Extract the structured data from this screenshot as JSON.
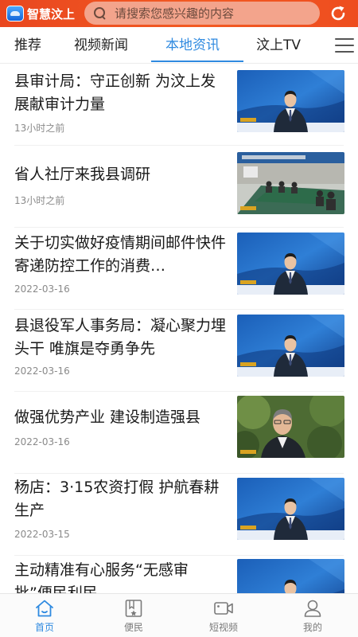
{
  "header": {
    "logo_text": "智慧汶上",
    "search_placeholder": "请搜索您感兴趣的内容",
    "accent_color": "#ee4d1f"
  },
  "tabs": [
    {
      "label": "推荐",
      "active": false
    },
    {
      "label": "视频新闻",
      "active": false
    },
    {
      "label": "本地资讯",
      "active": true
    },
    {
      "label": "汶上TV",
      "active": false
    }
  ],
  "tabs_menu_icon": "hamburger-menu-icon",
  "news": [
    {
      "title": "县审计局：守正创新 为汶上发展献审计力量",
      "meta": "13小时之前",
      "thumb": "anchor"
    },
    {
      "title": "省人社厅来我县调研",
      "meta": "13小时之前",
      "thumb": "meeting"
    },
    {
      "title": "关于切实做好疫情期间邮件快件寄递防控工作的消费…",
      "meta": "2022-03-16",
      "thumb": "anchor"
    },
    {
      "title": "县退役军人事务局：凝心聚力埋头干 唯旗是夺勇争先",
      "meta": "2022-03-16",
      "thumb": "anchor"
    },
    {
      "title": "做强优势产业 建设制造强县",
      "meta": "2022-03-16",
      "thumb": "interview"
    },
    {
      "title": "杨店：3·15农资打假 护航春耕生产",
      "meta": "2022-03-15",
      "thumb": "anchor"
    },
    {
      "title": "主动精准有心服务“无感审批”便民利民",
      "meta": "",
      "thumb": "anchor"
    }
  ],
  "bottom_nav": [
    {
      "label": "首页",
      "icon": "home-icon",
      "active": true
    },
    {
      "label": "便民",
      "icon": "bookmark-star-icon",
      "active": false
    },
    {
      "label": "短视频",
      "icon": "video-camera-icon",
      "active": false
    },
    {
      "label": "我的",
      "icon": "user-icon",
      "active": false
    }
  ],
  "colors": {
    "active_blue": "#2f8ae0",
    "header_orange": "#ee4d1f",
    "meta_gray": "#8a8a8a"
  }
}
